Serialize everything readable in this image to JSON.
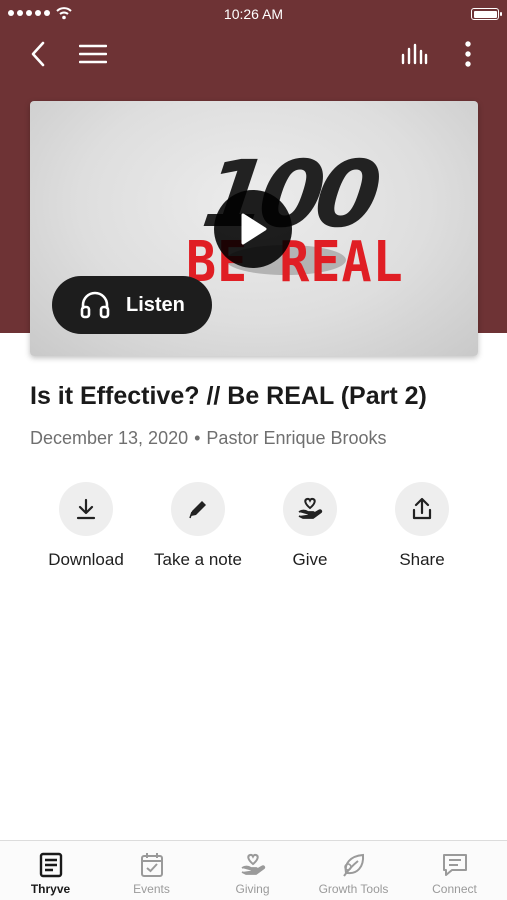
{
  "status_bar": {
    "time": "10:26 AM"
  },
  "video": {
    "logo_number": "100",
    "logo_text": "BE REAL",
    "listen_label": "Listen"
  },
  "sermon": {
    "title": "Is it Effective? // Be REAL (Part 2)",
    "date": "December 13, 2020",
    "separator": "•",
    "speaker": "Pastor Enrique Brooks"
  },
  "actions": [
    {
      "label": "Download",
      "icon": "download-icon"
    },
    {
      "label": "Take a note",
      "icon": "pencil-icon"
    },
    {
      "label": "Give",
      "icon": "heart-hand-icon"
    },
    {
      "label": "Share",
      "icon": "share-icon"
    }
  ],
  "tabs": [
    {
      "label": "Thryve",
      "icon": "book-icon",
      "active": true
    },
    {
      "label": "Events",
      "icon": "calendar-icon",
      "active": false
    },
    {
      "label": "Giving",
      "icon": "heart-hand-icon",
      "active": false
    },
    {
      "label": "Growth Tools",
      "icon": "leaf-icon",
      "active": false
    },
    {
      "label": "Connect",
      "icon": "chat-icon",
      "active": false
    }
  ],
  "colors": {
    "header_background": "#6e3335",
    "logo_red": "#e01e24",
    "tab_active": "#1a1a1a",
    "tab_inactive": "#9a9a9a"
  }
}
